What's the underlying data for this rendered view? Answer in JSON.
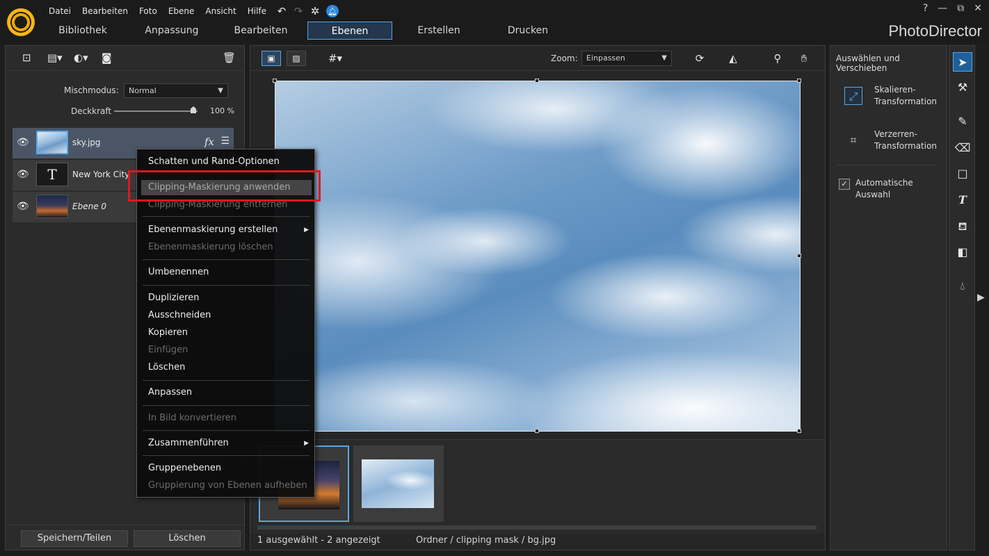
{
  "app": {
    "title": "PhotoDirector",
    "menu": [
      "Datei",
      "Bearbeiten",
      "Foto",
      "Ebene",
      "Ansicht",
      "Hilfe"
    ],
    "tabs": [
      "Bibliothek",
      "Anpassung",
      "Bearbeiten",
      "Ebenen",
      "Erstellen",
      "Drucken"
    ],
    "active_tab": "Ebenen",
    "window_controls": {
      "help": "?",
      "minimize": "—",
      "restore": "⧉",
      "close": "✕"
    }
  },
  "layers_panel": {
    "blend_label": "Mischmodus:",
    "blend_value": "Normal",
    "opacity_label": "Deckkraft",
    "opacity_value": "100 %",
    "opacity_fraction": 1.0,
    "layers": [
      {
        "name": "sky.jpg",
        "type": "image",
        "selected": true
      },
      {
        "name": "New York City",
        "type": "text",
        "thumb_glyph": "T"
      },
      {
        "name": "Ebene 0",
        "type": "image",
        "italic": true
      }
    ],
    "footer": {
      "save": "Speichern/Teilen",
      "delete": "Löschen"
    }
  },
  "canvas": {
    "zoom_label": "Zoom:",
    "zoom_value": "Einpassen",
    "status_selection": "1 ausgewählt - 2 angezeigt",
    "status_path": "Ordner / clipping mask / bg.jpg"
  },
  "right_panel": {
    "title": "Auswählen und Verschieben",
    "options": [
      {
        "label_line1": "Skalieren-",
        "label_line2": "Transformation"
      },
      {
        "label_line1": "Verzerren-",
        "label_line2": "Transformation"
      }
    ],
    "auto_select_line1": "Automatische",
    "auto_select_line2": "Auswahl",
    "auto_select_checked": true
  },
  "context_menu": {
    "items": [
      {
        "label": "Schatten und Rand-Optionen",
        "state": "enabled"
      },
      {
        "label": "Clipping-Maskierung anwenden",
        "state": "hover"
      },
      {
        "label": "Clipping-Maskierung entfernen",
        "state": "disabled"
      },
      {
        "label": "Ebenenmaskierung erstellen",
        "state": "enabled",
        "submenu": true
      },
      {
        "label": "Ebenenmaskierung löschen",
        "state": "disabled"
      },
      {
        "label": "Umbenennen",
        "state": "enabled"
      },
      {
        "label": "Duplizieren",
        "state": "enabled"
      },
      {
        "label": "Ausschneiden",
        "state": "enabled"
      },
      {
        "label": "Kopieren",
        "state": "enabled"
      },
      {
        "label": "Einfügen",
        "state": "disabled"
      },
      {
        "label": "Löschen",
        "state": "enabled"
      },
      {
        "label": "Anpassen",
        "state": "enabled"
      },
      {
        "label": "In Bild konvertieren",
        "state": "disabled"
      },
      {
        "label": "Zusammenführen",
        "state": "enabled",
        "submenu": true
      },
      {
        "label": "Gruppenebenen",
        "state": "enabled"
      },
      {
        "label": "Gruppierung von Ebenen aufheben",
        "state": "disabled"
      }
    ]
  },
  "colors": {
    "accent": "#5aa6e6",
    "highlight_box": "#e2171c",
    "logo": "#f2a900"
  },
  "icons": [
    "logo-icon",
    "undo-icon",
    "redo-icon",
    "settings-icon",
    "notification-icon",
    "eye-icon",
    "trash-icon",
    "fx-icon",
    "adjust-icon",
    "grid-icon",
    "rotate-icon",
    "flip-icon",
    "zoom-icon",
    "hand-icon",
    "select-arrow-icon",
    "brush-icon",
    "eraser-icon",
    "rectangle-icon",
    "text-tool-icon",
    "fill-icon",
    "gradient-icon",
    "droplet-icon"
  ]
}
